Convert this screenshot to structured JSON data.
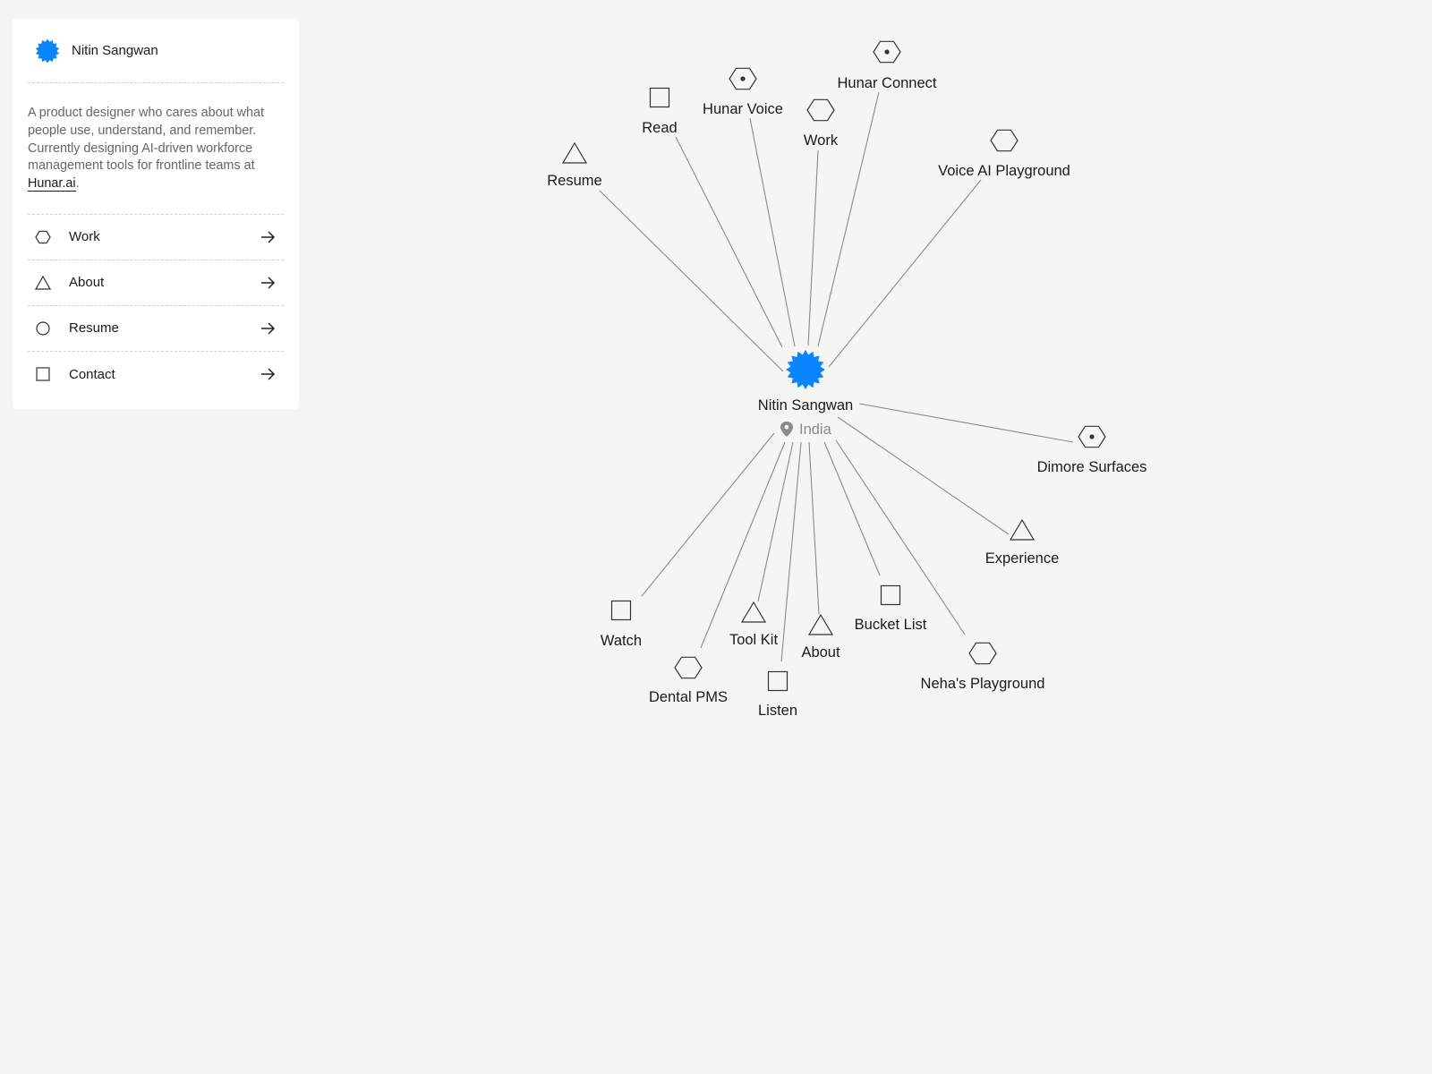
{
  "sidebar": {
    "name": "Nitin Sangwan",
    "bio_prefix": "A product designer who cares about what people use, understand, and remember. Currently designing AI-driven workforce management tools for frontline teams at ",
    "bio_link": "Hunar.ai",
    "bio_suffix": ".",
    "nav": [
      {
        "label": "Work",
        "icon": "hexagon-icon"
      },
      {
        "label": "About",
        "icon": "triangle-icon"
      },
      {
        "label": "Resume",
        "icon": "circle-icon"
      },
      {
        "label": "Contact",
        "icon": "square-icon"
      }
    ]
  },
  "graph": {
    "center": {
      "name": "Nitin Sangwan",
      "location": "India",
      "icon": "flower-logo-icon",
      "color": "#0a84ff"
    },
    "nodes": [
      {
        "label": "Resume",
        "shape": "triangle"
      },
      {
        "label": "Read",
        "shape": "square"
      },
      {
        "label": "Hunar Voice",
        "shape": "hexagon-dot"
      },
      {
        "label": "Work",
        "shape": "hexagon"
      },
      {
        "label": "Hunar Connect",
        "shape": "hexagon-dot"
      },
      {
        "label": "Voice AI Playground",
        "shape": "hexagon"
      },
      {
        "label": "Dimore Surfaces",
        "shape": "hexagon-dot"
      },
      {
        "label": "Experience",
        "shape": "triangle"
      },
      {
        "label": "Neha's Playground",
        "shape": "hexagon"
      },
      {
        "label": "Bucket List",
        "shape": "square"
      },
      {
        "label": "About",
        "shape": "triangle"
      },
      {
        "label": "Listen",
        "shape": "square"
      },
      {
        "label": "Tool Kit",
        "shape": "triangle"
      },
      {
        "label": "Dental PMS",
        "shape": "hexagon"
      },
      {
        "label": "Watch",
        "shape": "square"
      }
    ]
  }
}
